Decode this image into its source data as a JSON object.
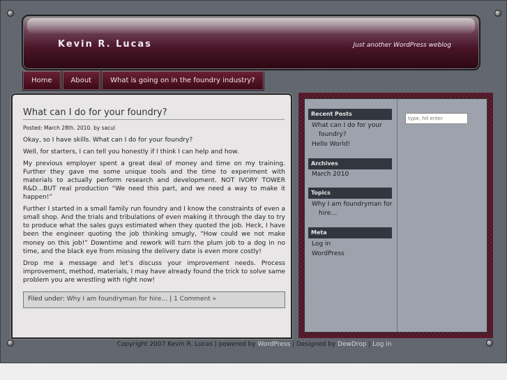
{
  "site": {
    "title": "Kevin R. Lucas",
    "tagline": "Just another WordPress weblog"
  },
  "nav": {
    "items": [
      {
        "label": "Home"
      },
      {
        "label": "About"
      },
      {
        "label": "What is going on in the foundry industry?"
      }
    ]
  },
  "post": {
    "title": "What can I do for your foundry?",
    "meta": "Posted: March 28th. 2010. by sacul",
    "paragraphs": [
      "Okay, so I have skills.  What can I do for your foundry?",
      "Well, for starters, I can tell you honestly if I think I can help and how.",
      "My previous employer spent a great deal of money and time on my training.  Further they gave me some unique tools and the time to experiment with materials to actually perform research and development.  NOT IVORY TOWER R&D…BUT real production “We need this part, and we need a way to make it happen!”",
      "Further I started in a small family run foundry and I know the constraints of even a small shop.  And the trials and tribulations of even making it through the day to try to produce what the sales guys estimated when they quoted the job.  Heck, I have been the engineer quoting the job thinking smugly, “How could we not make money on this job!” Downtime and rework will turn the plum job to a dog in no time, and the black eye from missing the delivery date is even more costly!",
      "Drop me a message and let’s discuss your improvement needs.  Process improvement, method, materials, I may have already found the trick to solve same problem you are wrestling with right now!"
    ],
    "filed_prefix": "Filed under: ",
    "filed_category": "Why I am foundryman for hire…",
    "filed_sep": " | ",
    "comments": "1 Comment »"
  },
  "sidebar": {
    "recent_title": "Recent Posts",
    "recent": [
      "What can I do for your",
      "foundry?",
      "Hello World!"
    ],
    "archives_title": "Archives",
    "archives": [
      "March 2010"
    ],
    "topics_title": "Topics",
    "topics": [
      "Why I am foundryman for",
      "hire…"
    ],
    "meta_title": "Meta",
    "meta": [
      "Log in",
      "WordPress"
    ],
    "search_placeholder": "type, hit enter"
  },
  "footer": {
    "copyright": "Copyright 2007 Kevin R. Lucas | powered by ",
    "powered": "WordPress",
    "designed_prefix": " | Designed by ",
    "designer": "DewDrop",
    "sep": " | ",
    "login": "Log in"
  }
}
